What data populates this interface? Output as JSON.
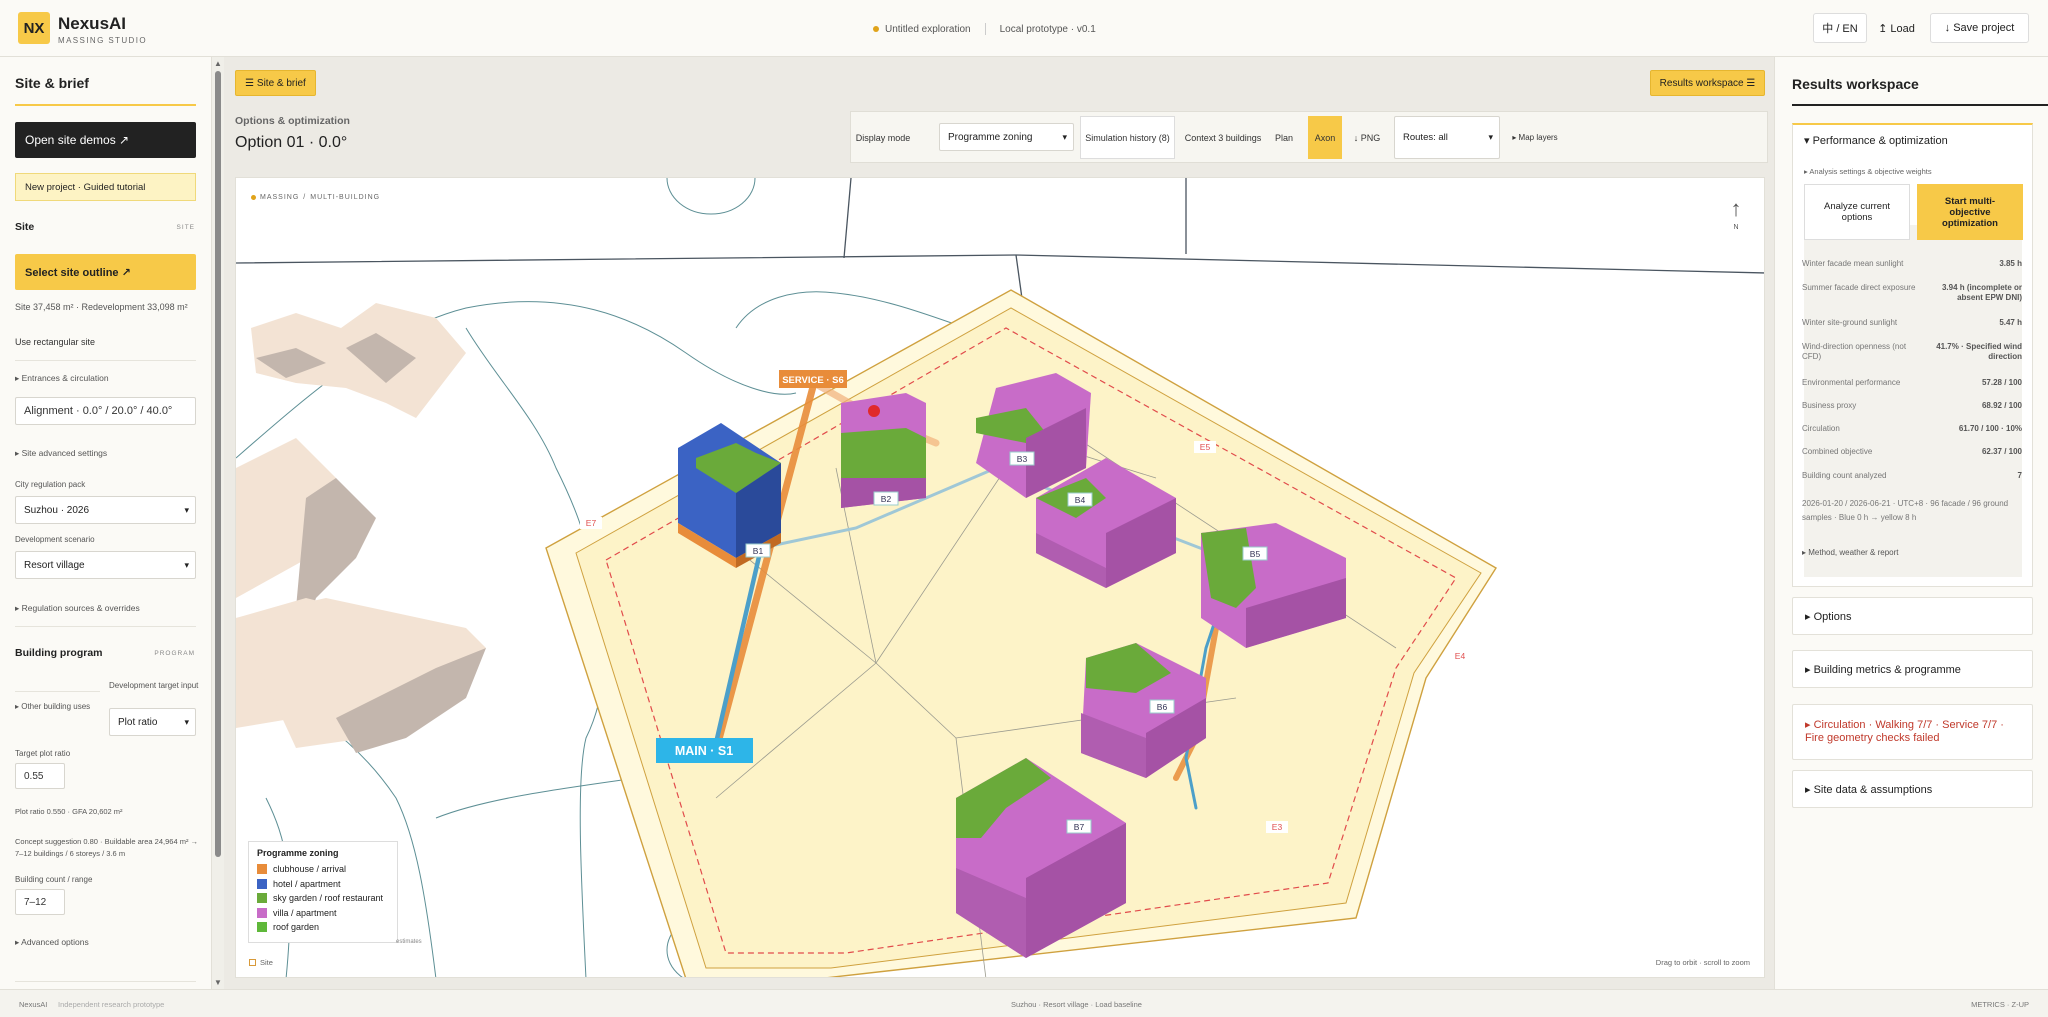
{
  "header": {
    "logo_text": "NX",
    "brand": "NexusAI",
    "brand_sub": "MASSING STUDIO",
    "status_title": "Untitled exploration",
    "status_version": "Local prototype · v0.1",
    "lang_label": "中 / EN",
    "load_label": "↥ Load",
    "save_label": "↓ Save project"
  },
  "sidebar": {
    "title": "Site & brief",
    "open_demos": "Open site demos ↗",
    "new_project": "New project · Guided tutorial",
    "site_heading": "Site",
    "site_tag": "SITE",
    "select_outline": "Select site outline ↗",
    "site_info": "Site 37,458 m² · Redevelopment 33,098 m²",
    "rect_site": "Use rectangular site",
    "entrances": "▸ Entrances & circulation",
    "alignment": "Alignment · 0.0° / 20.0° / 40.0°",
    "advanced_site": "▸ Site advanced settings",
    "reg_pack_label": "City regulation pack",
    "reg_pack_value": "Suzhou · 2026",
    "scenario_label": "Development scenario",
    "scenario_value": "Resort village",
    "reg_sources": "▸ Regulation sources & overrides",
    "program_heading": "Building program",
    "program_tag": "PROGRAM",
    "other_uses": "▸ Other building uses",
    "dev_target_label": "Development target input",
    "dev_target_value": "Plot ratio",
    "target_plot_label": "Target plot ratio",
    "target_plot_value": "0.55",
    "plot_gfa": "Plot ratio 0.550 · GFA 20,602 m²",
    "concept": "Concept suggestion 0.80 · Buildable area 24,964 m² → 7–12 buildings / 6 storeys / 3.6 m",
    "count_label": "Building count / range",
    "count_value": "7–12",
    "advanced_options": "▸ Advanced options"
  },
  "main": {
    "site_brief_chip": "☰ Site & brief",
    "results_chip": "Results workspace ☰",
    "subtitle": "Options & optimization",
    "option_title": "Option 01 · 0.0°",
    "toolbar": {
      "display_mode_label": "Display mode",
      "display_mode_value": "Programme zoning",
      "sim_history": "Simulation history (8)",
      "context": "Context 3 buildings",
      "plan": "Plan",
      "axon": "Axon",
      "png": "↓ PNG",
      "routes": "Routes: all",
      "map_layers": "▸ Map layers"
    },
    "canvas": {
      "breadcrumb_a": "MASSING",
      "breadcrumb_b": "MULTI-BUILDING",
      "north": "N",
      "service_label": "SERVICE · S6",
      "main_label": "MAIN · S1",
      "buildings": [
        "B1",
        "B2",
        "B3",
        "B4",
        "B5",
        "B6",
        "B7"
      ],
      "edges": [
        "E3",
        "E4",
        "E5",
        "E7"
      ],
      "hint": "Drag to orbit · scroll to zoom",
      "site_toggle": "Site",
      "estimates": "estimates"
    },
    "legend": {
      "title": "Programme zoning",
      "items": [
        {
          "label": "clubhouse / arrival",
          "color": "#e88c3a"
        },
        {
          "label": "hotel / apartment",
          "color": "#3b63c4"
        },
        {
          "label": "sky garden / roof restaurant",
          "color": "#6aaa3a"
        },
        {
          "label": "villa / apartment",
          "color": "#c86cc8"
        },
        {
          "label": "roof garden",
          "color": "#5fb83a"
        }
      ]
    }
  },
  "results": {
    "title": "Results workspace",
    "perf_heading": "▾ Performance & optimization",
    "analysis_settings": "▸ Analysis settings & objective weights",
    "analyze_btn": "Analyze current options",
    "optimize_btn": "Start multi-objective optimization",
    "metrics": [
      {
        "label": "Winter facade mean sunlight",
        "value": "3.85 h"
      },
      {
        "label": "Summer facade direct exposure",
        "value": "3.94 h (incomplete or absent EPW DNI)"
      },
      {
        "label": "Winter site-ground sunlight",
        "value": "5.47 h"
      },
      {
        "label": "Wind-direction openness (not CFD)",
        "value": "41.7% · Specified wind direction"
      },
      {
        "label": "Environmental performance",
        "value": "57.28 / 100"
      },
      {
        "label": "Business proxy",
        "value": "68.92 / 100"
      },
      {
        "label": "Circulation",
        "value": "61.70 / 100 · 10%"
      },
      {
        "label": "Combined objective",
        "value": "62.37 / 100"
      },
      {
        "label": "Building count analyzed",
        "value": "7"
      }
    ],
    "sample_note": "2026-01-20 / 2026-06-21 · UTC+8 · 96 facade / 96 ground samples · Blue 0 h → yellow 8 h",
    "method": "▸ Method, weather & report",
    "options": "▸ Options",
    "building_metrics": "▸ Building metrics & programme",
    "circulation_warn": "▸ Circulation · Walking 7/7 · Service 7/7 · Fire geometry checks failed",
    "site_data": "▸ Site data & assumptions",
    "warn_color": "#c0392b"
  },
  "footer": {
    "left_a": "NexusAI",
    "left_b": "Independent research prototype",
    "center": "Suzhou · Resort village · Load baseline",
    "right": "METRICS · Z-UP"
  }
}
